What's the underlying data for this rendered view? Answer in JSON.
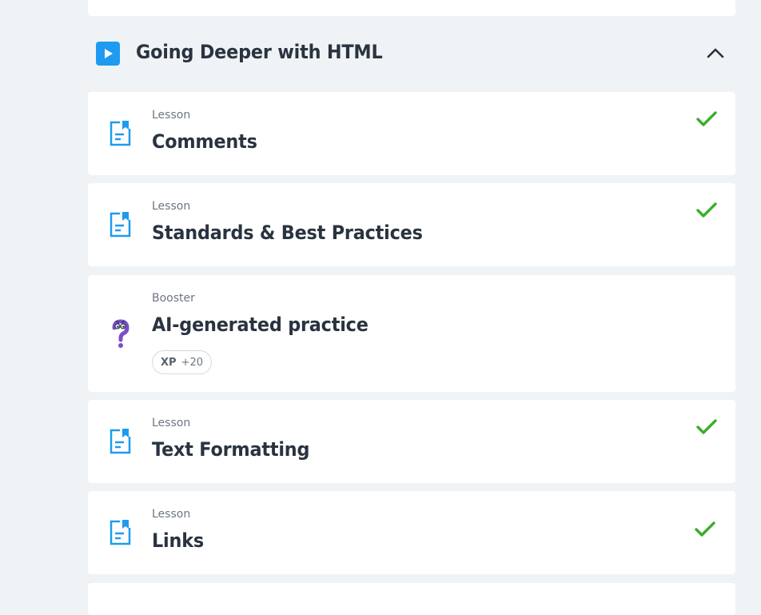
{
  "section": {
    "title": "Going Deeper with HTML",
    "play_icon": "play-icon",
    "toggle_icon": "chevron-up-icon"
  },
  "items": [
    {
      "type": "Lesson",
      "title": "Comments",
      "icon": "lesson-document-icon",
      "completed": true
    },
    {
      "type": "Lesson",
      "title": "Standards & Best Practices",
      "icon": "lesson-document-icon",
      "completed": true
    },
    {
      "type": "Booster",
      "title": "AI-generated practice",
      "icon": "question-mark-character-icon",
      "completed": false,
      "xp_label": "XP",
      "xp_value": "+20"
    },
    {
      "type": "Lesson",
      "title": "Text Formatting",
      "icon": "lesson-document-icon",
      "completed": true
    },
    {
      "type": "Lesson",
      "title": "Links",
      "icon": "lesson-document-icon",
      "completed": true
    }
  ],
  "colors": {
    "accent": "#1e9bf0",
    "check": "#3aae2a",
    "booster": "#7c4dcc",
    "background": "#f0f3f6",
    "card": "#ffffff"
  }
}
